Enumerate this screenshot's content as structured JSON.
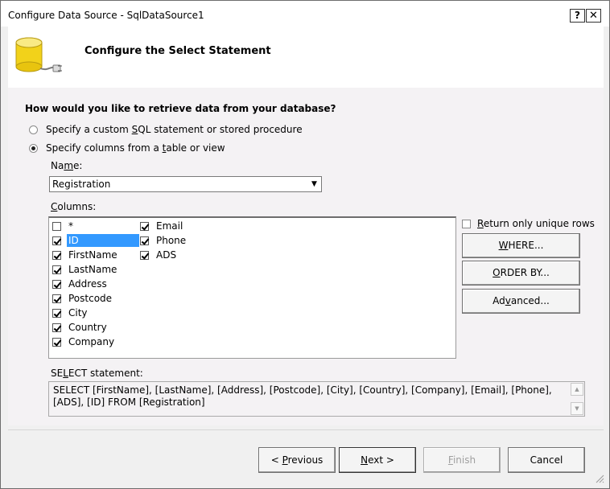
{
  "window": {
    "title": "Configure Data Source - SqlDataSource1",
    "help": "?",
    "close": "✕"
  },
  "header": {
    "title": "Configure the Select Statement"
  },
  "question": "How would you like to retrieve data from your database?",
  "options": [
    {
      "label": "Specify a custom SQL statement or stored procedure",
      "checked": false
    },
    {
      "label": "Specify columns from a table or view",
      "checked": true
    }
  ],
  "name_label": "Name:",
  "name_value": "Registration",
  "columns_label": "Columns:",
  "columns": [
    {
      "label": "*",
      "checked": false
    },
    {
      "label": "ID",
      "checked": true,
      "selected": true
    },
    {
      "label": "FirstName",
      "checked": true
    },
    {
      "label": "LastName",
      "checked": true
    },
    {
      "label": "Address",
      "checked": true
    },
    {
      "label": "Postcode",
      "checked": true
    },
    {
      "label": "City",
      "checked": true
    },
    {
      "label": "Country",
      "checked": true
    },
    {
      "label": "Company",
      "checked": true
    },
    {
      "label": "Email",
      "checked": true
    },
    {
      "label": "Phone",
      "checked": true
    },
    {
      "label": "ADS",
      "checked": true
    }
  ],
  "unique_rows_label": "Return only unique rows",
  "side_buttons": {
    "where": "WHERE...",
    "orderby": "ORDER BY...",
    "advanced": "Advanced..."
  },
  "select_statement_label": "SELECT statement:",
  "select_statement": "SELECT [FirstName], [LastName], [Address], [Postcode], [City], [Country], [Company], [Email], [Phone], [ADS], [ID] FROM [Registration]",
  "footer": {
    "previous": "< Previous",
    "next": "Next >",
    "finish": "Finish",
    "cancel": "Cancel"
  },
  "colors": {
    "selection": "#3399ff",
    "icon_yellow": "#f2d21a"
  }
}
